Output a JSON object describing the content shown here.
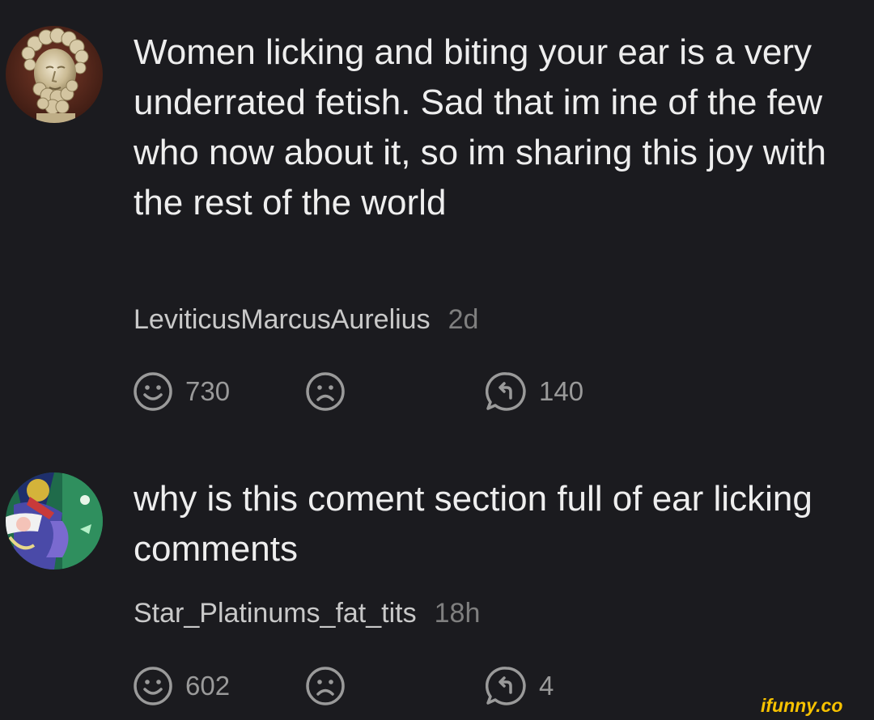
{
  "comments": [
    {
      "text": "Women licking and biting your ear is a very underrated fetish. Sad that im ine of the few who now about it, so im sharing this joy with the rest of the world",
      "username": "LeviticusMarcusAurelius",
      "time": "2d",
      "smile_count": "730",
      "reply_count": "140",
      "avatar_icon": "marble-bust-avatar"
    },
    {
      "text": "why is this coment section full of ear licking comments",
      "username": "Star_Platinums_fat_tits",
      "time": "18h",
      "smile_count": "602",
      "reply_count": "4",
      "avatar_icon": "anime-character-avatar"
    }
  ],
  "icons": {
    "smile": "smile-face-icon",
    "sad": "sad-face-icon",
    "reply": "reply-bubble-icon"
  },
  "watermark": {
    "text": "ifunny.co",
    "color": "#f7c200"
  },
  "colors": {
    "background": "#1b1b1f",
    "text": "#eeeeee",
    "username": "#c9c9c9",
    "muted": "#7f7f7f",
    "icon": "#9a9a9a"
  }
}
